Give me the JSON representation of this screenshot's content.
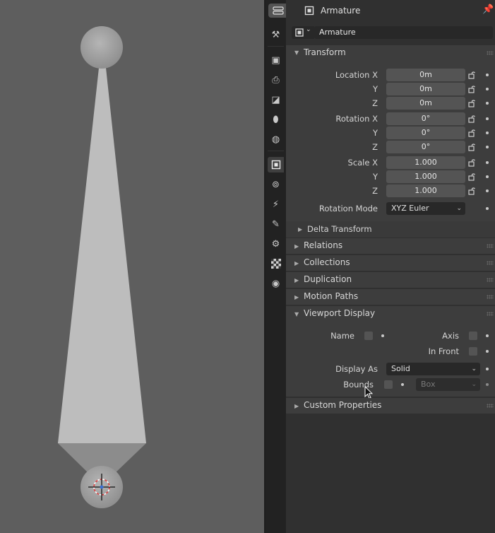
{
  "header": {
    "object_name": "Armature",
    "data_name": "Armature"
  },
  "tabs": [
    "tool-icon",
    "render-icon",
    "output-icon",
    "view-layer-icon",
    "scene-icon",
    "world-icon",
    "object-icon",
    "modifiers-icon",
    "particles-icon",
    "physics-icon",
    "constraints-icon",
    "data-icon",
    "texture-icon"
  ],
  "transform": {
    "title": "Transform",
    "rows": [
      {
        "label": "Location X",
        "value": "0m"
      },
      {
        "label": "Y",
        "value": "0m"
      },
      {
        "label": "Z",
        "value": "0m"
      },
      {
        "label": "Rotation X",
        "value": "0°"
      },
      {
        "label": "Y",
        "value": "0°"
      },
      {
        "label": "Z",
        "value": "0°"
      },
      {
        "label": "Scale X",
        "value": "1.000"
      },
      {
        "label": "Y",
        "value": "1.000"
      },
      {
        "label": "Z",
        "value": "1.000"
      }
    ],
    "rotation_mode_label": "Rotation Mode",
    "rotation_mode_value": "XYZ Euler",
    "delta_title": "Delta Transform"
  },
  "sections": {
    "relations": "Relations",
    "collections": "Collections",
    "duplication": "Duplication",
    "motion_paths": "Motion Paths",
    "viewport_display": "Viewport Display",
    "custom_properties": "Custom Properties"
  },
  "viewport_display": {
    "name_label": "Name",
    "axis_label": "Axis",
    "in_front_label": "In Front",
    "display_as_label": "Display As",
    "display_as_value": "Solid",
    "bounds_label": "Bounds",
    "bounds_value": "Box"
  },
  "colors": {
    "viewport_bg": "#5e5e5e",
    "panel_bg": "#303030",
    "field_bg": "#545454",
    "accent_cursor": "#e04040"
  }
}
